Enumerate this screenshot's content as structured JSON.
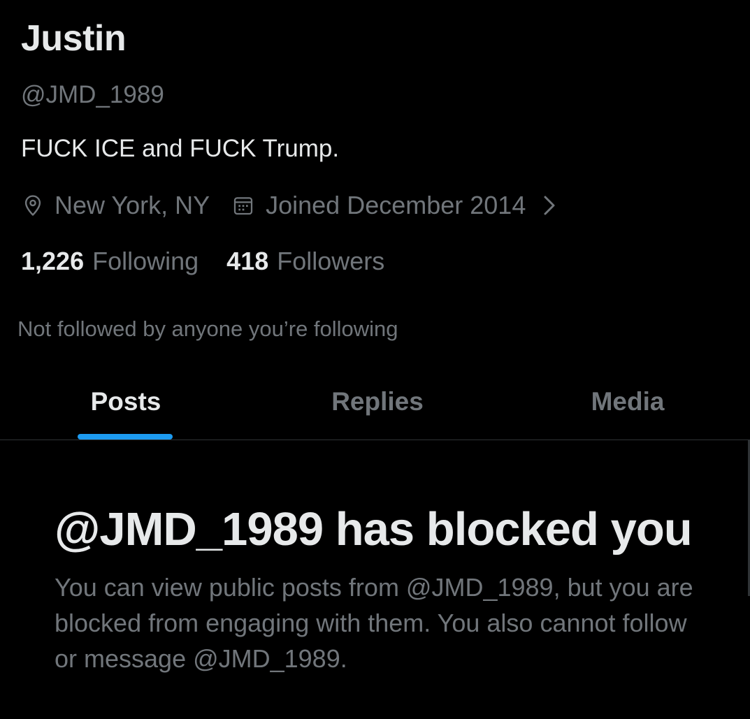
{
  "profile": {
    "display_name": "Justin",
    "handle": "@JMD_1989",
    "bio": "FUCK ICE and FUCK Trump.",
    "location": "New York, NY",
    "joined": "Joined December 2014",
    "following_count": "1,226",
    "following_label": "Following",
    "followers_count": "418",
    "followers_label": "Followers",
    "followed_by": "Not followed by anyone you’re following"
  },
  "tabs": [
    {
      "label": "Posts",
      "active": true
    },
    {
      "label": "Replies",
      "active": false
    },
    {
      "label": "Media",
      "active": false
    }
  ],
  "blocked": {
    "title": "@JMD_1989 has blocked you",
    "message": "You can view public posts from @JMD_1989, but you are blocked from engaging with them. You also cannot follow or message @JMD_1989."
  },
  "icons": {
    "location": "location-pin-icon",
    "joined": "calendar-icon",
    "more": "chevron-right-icon"
  },
  "colors": {
    "background": "#000000",
    "primary_text": "#e7e9ea",
    "secondary_text": "#71767b",
    "accent": "#1d9bf0",
    "divider": "#2f3336"
  }
}
